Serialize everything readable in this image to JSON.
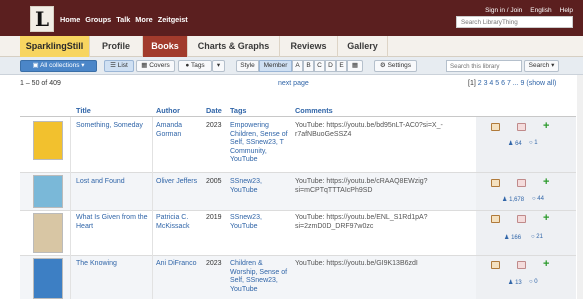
{
  "header": {
    "logo_letter": "L",
    "nav": [
      "Home",
      "Groups",
      "Talk",
      "More",
      "Zeitgeist"
    ],
    "top_links": [
      "Sign in / Join",
      "English",
      "Help"
    ],
    "search_placeholder": "Search LibraryThing"
  },
  "tabs": {
    "user": "SparklingStill",
    "items": [
      "Profile",
      "Books",
      "Charts & Graphs",
      "Reviews",
      "Gallery"
    ],
    "active": "Books"
  },
  "toolbar": {
    "collections": "All collections",
    "list": "List",
    "covers": "Covers",
    "tags": "Tags",
    "style_label": "Style",
    "styles": [
      "Member",
      "A",
      "B",
      "C",
      "D",
      "E"
    ],
    "active_style": "Member",
    "settings": "Settings",
    "search_placeholder": "Search this library",
    "search_button": "Search"
  },
  "pagination": {
    "range": "1 – 50 of 409",
    "next_page": "next page",
    "current": "[1]",
    "pages": "2 3 4 5 6 7 ... 9",
    "show_all": "(show all)"
  },
  "columns": [
    "Title",
    "Author",
    "Date",
    "Tags",
    "Comments"
  ],
  "rows": [
    {
      "title": "Something, Someday",
      "author": "Amanda Gorman",
      "date": "2023",
      "tags": "Empowering Children, Sense of Self, SSnew23, T Community, YouTube",
      "comment": "YouTube: https://youtu.be/bd95nLT-AC0?si=X_-r7afNBuoGeSSZ4",
      "members": "64",
      "reviews": "1",
      "cover_color": "#f2c12e"
    },
    {
      "title": "Lost and Found",
      "author": "Oliver Jeffers",
      "date": "2005",
      "tags": "SSnew23, YouTube",
      "comment": "YouTube: https://youtu.be/cRAAQ8EWzig?si=mCPTqTTTAIcPh9SD",
      "members": "1,678",
      "reviews": "44",
      "cover_color": "#7ab8d8"
    },
    {
      "title": "What Is Given from the Heart",
      "author": "Patricia C. McKissack",
      "date": "2019",
      "tags": "SSnew23, YouTube",
      "comment": "YouTube: https://youtu.be/ENL_S1Rd1pA?si=2zmD0D_DRF97w0zc",
      "members": "166",
      "reviews": "21",
      "cover_color": "#d8c6a4"
    },
    {
      "title": "The Knowing",
      "author": "Ani DiFranco",
      "date": "2023",
      "tags": "Children & Worship, Sense of Self, SSnew23, YouTube",
      "comment": "YouTube: https://youtu.be/GI9K13B6zdI",
      "members": "13",
      "reviews": "0",
      "cover_color": "#3d7fc4"
    }
  ]
}
